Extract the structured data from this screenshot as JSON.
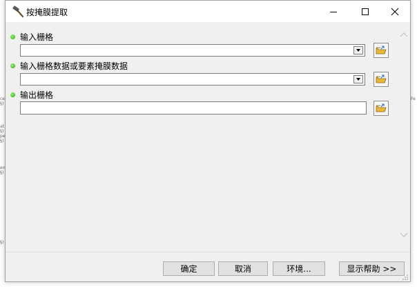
{
  "dialog": {
    "title": "按掩膜提取",
    "title_icon": "hammer-icon"
  },
  "window_controls": [
    "minimize-icon",
    "maximize-icon",
    "close-icon"
  ],
  "parameters": [
    {
      "label": "输入栅格",
      "control": "combo",
      "value": ""
    },
    {
      "label": "输入栅格数据或要素掩膜数据",
      "control": "combo",
      "value": ""
    },
    {
      "label": "输出栅格",
      "control": "textbox",
      "value": ""
    }
  ],
  "buttons": {
    "ok": "确定",
    "cancel": "取消",
    "environments": "环境...",
    "show_help": "显示帮助 >>"
  },
  "colors": {
    "required_dot": "#2aa80c",
    "dialog_bg": "#f0f0f0",
    "folder": "#e8b838"
  }
}
